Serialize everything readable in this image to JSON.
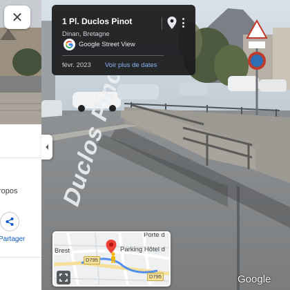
{
  "left_panel": {
    "close_glyph": "✕",
    "about_label": "ropos",
    "share_label": "Partager",
    "icons": {
      "close": "close-icon",
      "share": "share-icon"
    }
  },
  "info_card": {
    "title": "1 Pl. Duclos Pinot",
    "subtitle": "Dinan, Bretagne",
    "source": "Google Street View",
    "date": "févr. 2023",
    "more_dates_link": "Voir plus de dates",
    "icons": {
      "pin": "location-pin-icon",
      "more": "more-vert-icon",
      "logo": "google-g-logo"
    }
  },
  "street": {
    "road_name": "Duclos Pinot"
  },
  "minimap": {
    "place_brest": "Brest",
    "place_porte": "Porte d",
    "place_parking": "Parking Hôtel d",
    "road_1": "D795",
    "road_2": "D795",
    "colors": {
      "marker": "#ea4335",
      "pegman": "#f4b400",
      "route": "#4285f4"
    }
  },
  "watermark": "Google"
}
